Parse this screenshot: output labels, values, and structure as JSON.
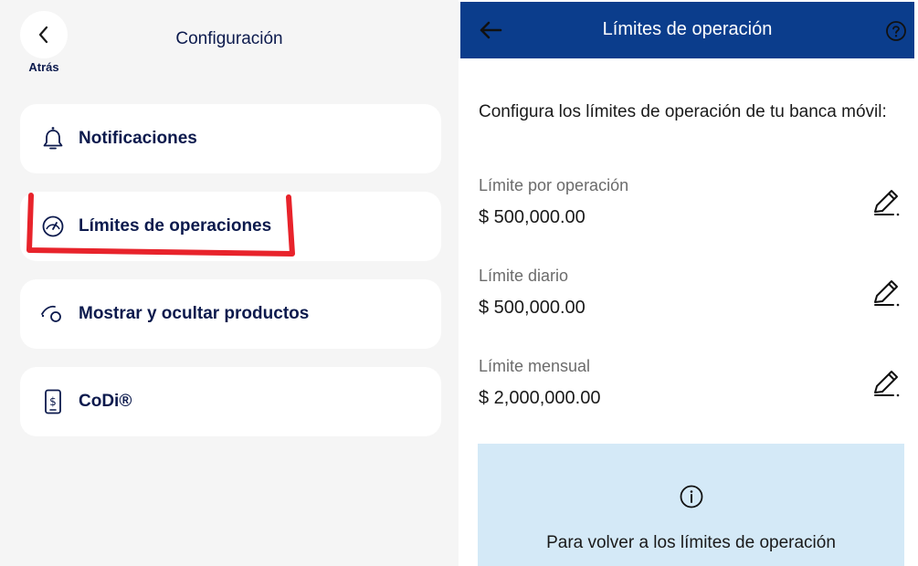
{
  "left": {
    "back_label": "Atrás",
    "title": "Configuración",
    "menu": [
      {
        "label": "Notificaciones",
        "icon": "bell-icon"
      },
      {
        "label": "Límites de operaciones",
        "icon": "gauge-icon"
      },
      {
        "label": "Mostrar y ocultar productos",
        "icon": "eye-toggle-icon"
      },
      {
        "label": "CoDi®",
        "icon": "mobile-payment-icon"
      }
    ],
    "highlight_color": "#e8232b"
  },
  "right": {
    "header_title": "Límites de operación",
    "intro": "Configura los límites de operación de tu banca móvil:",
    "limits": [
      {
        "label": "Límite por operación",
        "value": "$ 500,000.00"
      },
      {
        "label": "Límite diario",
        "value": "$ 500,000.00"
      },
      {
        "label": "Límite mensual",
        "value": "$ 2,000,000.00"
      }
    ],
    "info_text": "Para volver a los límites de operación"
  },
  "colors": {
    "header_bg": "#0b3d8c",
    "text_navy": "#0c1a4d",
    "info_bg": "#d4e9f7"
  }
}
